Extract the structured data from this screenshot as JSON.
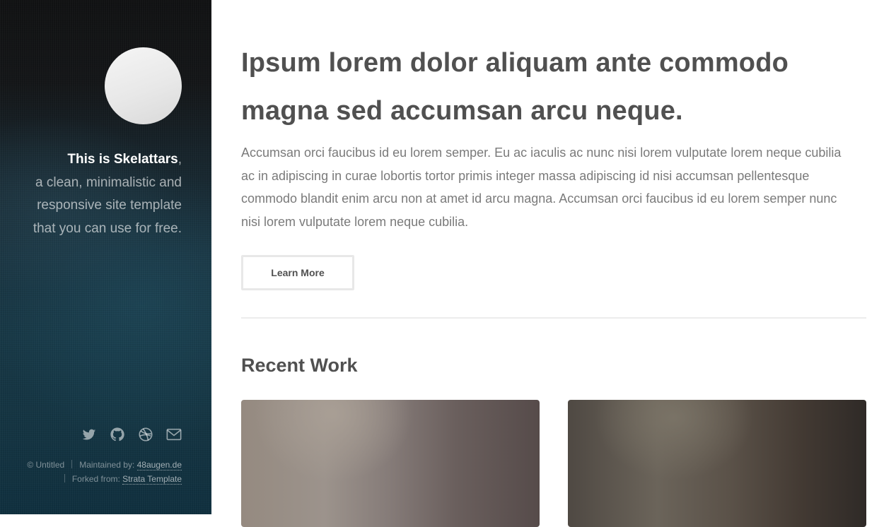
{
  "sidebar": {
    "intro": {
      "name": "This is Skelattars",
      "comma": ",",
      "line1": "a clean, minimalistic and",
      "line2": "responsive site template",
      "line3": "that you can use for free."
    },
    "social_icons": [
      "twitter-icon",
      "github-icon",
      "dribbble-icon",
      "envelope-icon"
    ],
    "footer": {
      "copyright": "© Untitled",
      "maintained_label": "Maintained by: ",
      "maintained_link": "48augen.de",
      "forked_label": "Forked from: ",
      "forked_link": "Strata Template"
    }
  },
  "main": {
    "title_line1": "Ipsum lorem dolor aliquam ante commodo",
    "title_line2": "magna sed accumsan arcu neque.",
    "lead": "Accumsan orci faucibus id eu lorem semper. Eu ac iaculis ac nunc nisi lorem vulputate lorem neque cubilia ac in adipiscing in curae lobortis tortor primis integer massa adipiscing id nisi accumsan pellentesque commodo blandit enim arcu non at amet id arcu magna. Accumsan orci faucibus id eu lorem semper nunc nisi lorem vulputate lorem neque cubilia.",
    "button_label": "Learn More",
    "section_title": "Recent Work"
  },
  "colors": {
    "heading": "#505050",
    "body_text": "#7a7a7a",
    "sidebar_dark": "#111213",
    "sidebar_teal": "#1a3441"
  }
}
